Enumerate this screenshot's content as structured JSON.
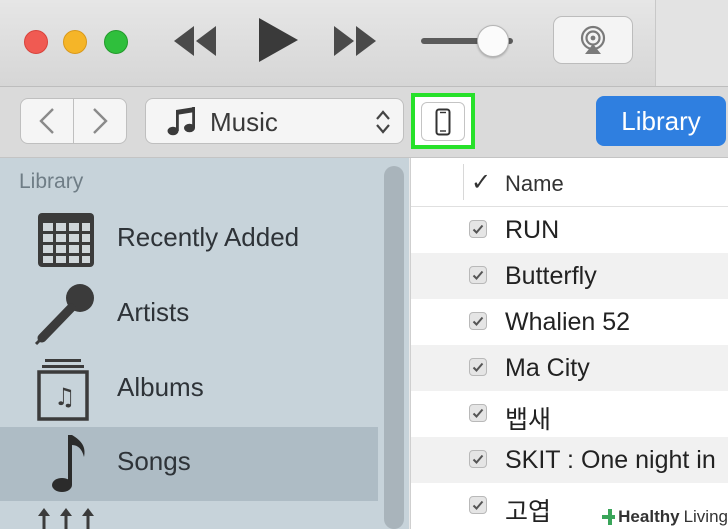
{
  "toolbar": {
    "media_select": {
      "label": "Music"
    },
    "library_button": "Library"
  },
  "sidebar": {
    "heading": "Library",
    "items": [
      {
        "label": "Recently Added",
        "icon": "calendar-grid-icon"
      },
      {
        "label": "Artists",
        "icon": "microphone-icon"
      },
      {
        "label": "Albums",
        "icon": "album-stack-icon"
      },
      {
        "label": "Songs",
        "icon": "music-note-icon",
        "selected": true
      }
    ]
  },
  "song_list": {
    "columns": {
      "check": "✓",
      "name": "Name"
    },
    "rows": [
      {
        "name": "RUN",
        "checked": true
      },
      {
        "name": "Butterfly",
        "checked": true
      },
      {
        "name": "Whalien 52",
        "checked": true
      },
      {
        "name": "Ma City",
        "checked": true
      },
      {
        "name": "뱁새",
        "checked": true
      },
      {
        "name": "SKIT : One night in",
        "checked": true
      },
      {
        "name": "고엽",
        "checked": true
      }
    ]
  },
  "watermark": {
    "brand": "Healthy",
    "suffix": "Living"
  },
  "colors": {
    "accent": "#2f7fe0",
    "highlight": "#27e12a",
    "sidebar": "#c7d3da"
  }
}
